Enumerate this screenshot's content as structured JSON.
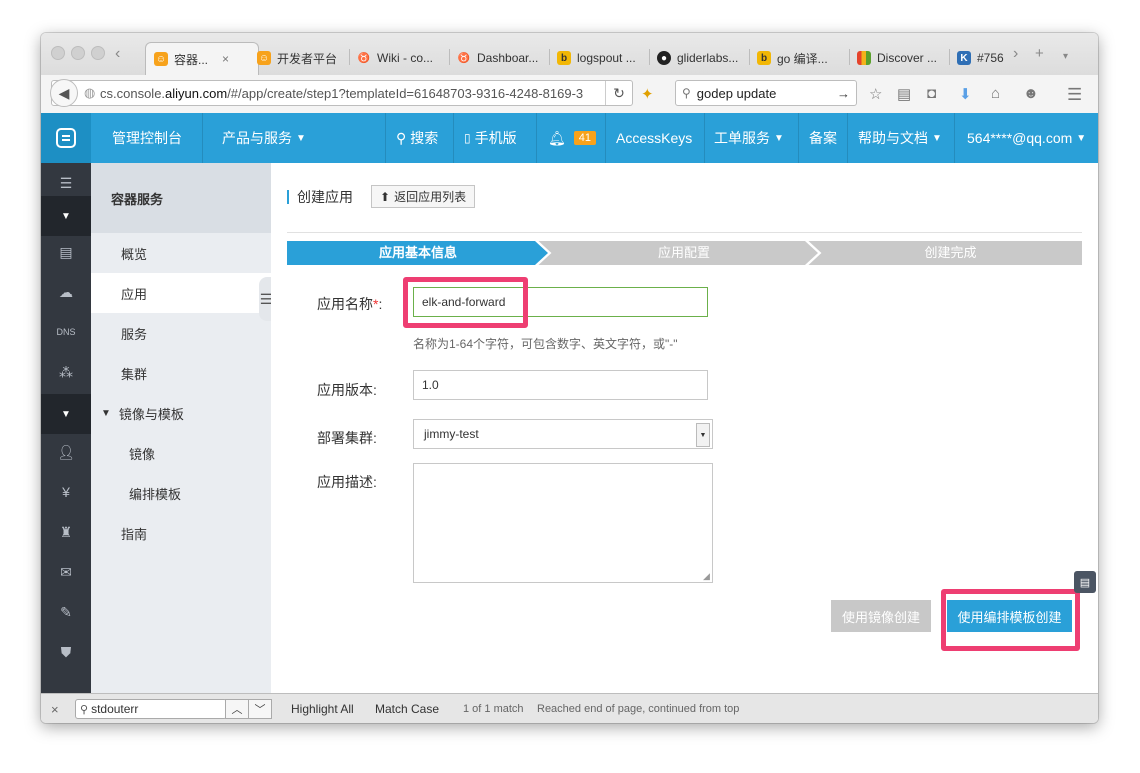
{
  "browser": {
    "tabs": [
      {
        "label": "容器...",
        "active": true,
        "icon": "aliyun-icon"
      },
      {
        "label": "开发者平台",
        "icon": "aliyun-icon"
      },
      {
        "label": "Wiki - co...",
        "icon": "wolf-icon"
      },
      {
        "label": "Dashboar...",
        "icon": "wolf-icon"
      },
      {
        "label": "logspout ...",
        "icon": "bing-icon"
      },
      {
        "label": "gliderlabs...",
        "icon": "github-icon"
      },
      {
        "label": "go 编译...",
        "icon": "bing-icon"
      },
      {
        "label": "Discover ...",
        "icon": "books-icon"
      },
      {
        "label": "#756",
        "icon": "k-icon"
      }
    ],
    "tab_close": "×",
    "new_tab": "+",
    "url_prefix": "cs.console.",
    "url_domain": "aliyun.com",
    "url_suffix": "/#/app/create/step1?templateId=61648703-9316-4248-8169-3",
    "search_value": "godep update"
  },
  "header": {
    "console": "管理控制台",
    "products": "产品与服务",
    "search": "搜索",
    "mobile": "手机版",
    "notifications": "41",
    "accesskeys": "AccessKeys",
    "tickets": "工单服务",
    "beian": "备案",
    "help": "帮助与文档",
    "user": "564****@qq.com"
  },
  "sidebar": {
    "title": "容器服务",
    "items": [
      {
        "label": "概览"
      },
      {
        "label": "应用"
      },
      {
        "label": "服务"
      },
      {
        "label": "集群"
      },
      {
        "label": "镜像与模板"
      },
      {
        "label": "镜像"
      },
      {
        "label": "编排模板"
      },
      {
        "label": "指南"
      }
    ]
  },
  "page": {
    "title": "创建应用",
    "back_button": "返回应用列表",
    "steps": [
      "应用基本信息",
      "应用配置",
      "创建完成"
    ]
  },
  "form": {
    "name_label": "应用名称",
    "required_mark": "*",
    "name_colon": ":",
    "name_value": "elk-and-forward",
    "name_hint": "名称为1-64个字符，可包含数字、英文字符，或\"-\"",
    "version_label": "应用版本:",
    "version_value": "1.0",
    "cluster_label": "部署集群:",
    "cluster_value": "jimmy-test",
    "desc_label": "应用描述:",
    "desc_value": ""
  },
  "actions": {
    "image_create": "使用镜像创建",
    "template_create": "使用编排模板创建"
  },
  "findbar": {
    "query": "stdouterr",
    "highlight_all": "Highlight All",
    "match_case": "Match Case",
    "match_count": "1 of 1 match",
    "status": "Reached end of page, continued from top"
  },
  "colors": {
    "accent": "#2aa0d8",
    "highlight": "#ee3e72",
    "badge": "#f7a21b"
  }
}
